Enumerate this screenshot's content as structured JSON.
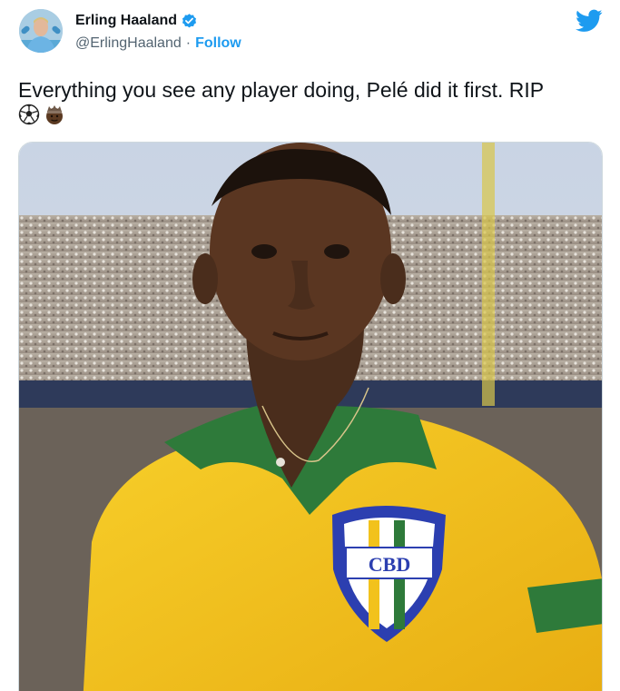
{
  "author": {
    "display_name": "Erling Haaland",
    "handle": "@ErlingHaaland",
    "separator": "·",
    "follow_label": "Follow",
    "verified": true
  },
  "tweet": {
    "text": "Everything you see any player doing, Pelé did it first. RIP",
    "emojis": [
      "soccer-ball-icon",
      "crown-face-icon"
    ]
  },
  "media": {
    "photo": {
      "badge_text": "CBD"
    }
  },
  "colors": {
    "accent": "#1d9bf0",
    "text": "#0f1419",
    "muted": "#536471",
    "jersey_yellow": "#f2c21c",
    "collar_green": "#2e7a3a"
  },
  "icons": {
    "brand": "twitter-bird-icon",
    "verified": "verified-badge-icon"
  }
}
